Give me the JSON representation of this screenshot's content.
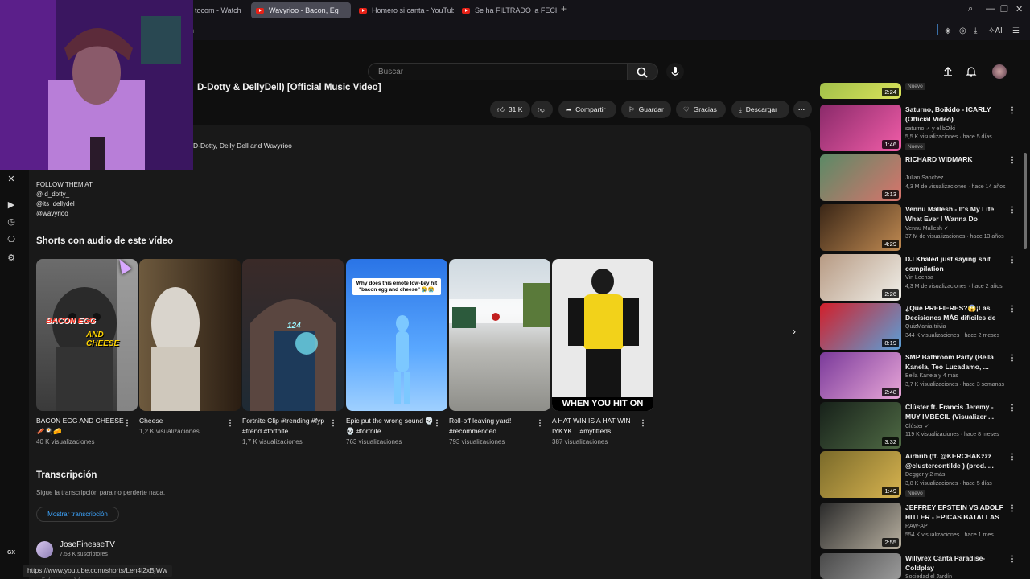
{
  "browser": {
    "tabs": [
      {
        "label": "tocom - Watch",
        "active": false
      },
      {
        "label": "Wavyrioo - Bacon, Eg",
        "active": true
      },
      {
        "label": "Homero si canta - YouTub",
        "active": false
      },
      {
        "label": "Se ha FILTRADO la FECHA",
        "active": false
      }
    ],
    "new_tab": "+",
    "address_fragment": "h",
    "ai_label": "AI"
  },
  "sidebar_gx": {
    "label": "GX"
  },
  "header": {
    "search_placeholder": "Buscar"
  },
  "video": {
    "title": "D-Dotty & DellyDell) [Official Music Video]",
    "actions": {
      "likes": "31 K",
      "share": "Compartir",
      "save": "Guardar",
      "thanks": "Gracias",
      "download": "Descargar"
    }
  },
  "description": {
    "artists": "D-Dotty, Delly Dell and Wavyrioo",
    "follow_lines": [
      "FOLLOW THEM AT",
      "@ d_dotty_",
      "@its_dellydel",
      "@wavyrioo"
    ]
  },
  "shorts": {
    "heading": "Shorts con audio de este vídeo",
    "items": [
      {
        "title": "BACON EGG AND CHEESE 🥓🍳🧀 ...",
        "views": "40 K visualizaciones",
        "caption1": "BACON EGG",
        "caption2": "AND CHEESE"
      },
      {
        "title": "Cheese",
        "views": "1,2 K visualizaciones"
      },
      {
        "title": "Fortnite Clip #trending #fyp #trend #fortnite",
        "views": "1,7 K visualizaciones",
        "caption1": "124"
      },
      {
        "title": "Epic put the wrong sound 💀💀 #fortnite ...",
        "views": "763 visualizaciones",
        "caption1": "Why does this emote low-key hit \"bacon egg and cheese\" 😭😭"
      },
      {
        "title": "Roll-off leaving yard! #recommended ...",
        "views": "793 visualizaciones"
      },
      {
        "title": "A HAT WIN IS A HAT WIN IYKYK ...#myfitteds ...",
        "views": "387 visualizaciones",
        "caption1": "WHEN YOU HIT ON"
      }
    ]
  },
  "transcript": {
    "heading": "Transcripción",
    "subtitle": "Sigue la transcripción para no perderte nada.",
    "button": "Mostrar transcripción"
  },
  "channel": {
    "name": "JoseFinesseTV",
    "subs": "7,53 K suscriptores"
  },
  "status_url": "https://www.youtube.com/shorts/Len4l2xBjWw",
  "under_tabs": "[▶] Vídeos    [ℹ] Información",
  "related": [
    {
      "title": "",
      "channel": "",
      "meta": "",
      "badge": "Nuevo",
      "duration": "2:24",
      "colors": [
        "#a2c04a",
        "#d9e25a"
      ]
    },
    {
      "title": "Saturno, Boikido - ICARLY (Official Video)",
      "channel": "saturno ✓ y el bOiki",
      "meta": "5,5 K visualizaciones · hace 5 días",
      "badge": "Nuevo",
      "duration": "1:46",
      "colors": [
        "#8a2a6a",
        "#f15da8"
      ]
    },
    {
      "title": "RICHARD WIDMARK",
      "channel": "Julian Sanchez",
      "meta": "4,3 M de visualizaciones · hace 14 años",
      "badge": "",
      "duration": "2:13",
      "colors": [
        "#5a8a66",
        "#d8746c"
      ]
    },
    {
      "title": "Vennu Mallesh - It's My Life What Ever I Wanna Do",
      "channel": "Vennu Mallesh ✓",
      "meta": "37 M de visualizaciones · hace 13 años",
      "badge": "",
      "duration": "4:29",
      "colors": [
        "#3a2616",
        "#c08a52"
      ]
    },
    {
      "title": "DJ Khaled just saying shit compilation",
      "channel": "Vin Leensa",
      "meta": "4,3 M de visualizaciones · hace 2 años",
      "badge": "",
      "duration": "2:26",
      "colors": [
        "#b79a83",
        "#f0efe9"
      ]
    },
    {
      "title": "¿Qué PREFIERES?😱¡Las Decisiones MÁS difíciles de T...",
      "channel": "QuizMania-trivia",
      "meta": "344 K visualizaciones · hace 2 meses",
      "badge": "",
      "duration": "8:19",
      "colors": [
        "#d21f2a",
        "#5aa0d8"
      ]
    },
    {
      "title": "SMP Bathroom Party (Bella Kanela, Teo Lucadamo, ...",
      "channel": "Bella Kanela y 4 más",
      "meta": "3,7 K visualizaciones · hace 3 semanas",
      "badge": "",
      "duration": "2:48",
      "colors": [
        "#7a3a9a",
        "#e8a6d8"
      ]
    },
    {
      "title": "Clúster ft. Francis Jeremy - MUY IMBÉCIL (Visualizer ...",
      "channel": "Clúster ✓",
      "meta": "119 K visualizaciones · hace 8 meses",
      "badge": "",
      "duration": "3:32",
      "colors": [
        "#17211a",
        "#4f6a44"
      ]
    },
    {
      "title": "Airbrib (ft. @KERCHAKzzz @clustercontilde ) (prod. ...",
      "channel": "Degger y 2 más",
      "meta": "3,8 K visualizaciones · hace 5 días",
      "badge": "Nuevo",
      "duration": "1:49",
      "colors": [
        "#7a6a2a",
        "#d8b450"
      ]
    },
    {
      "title": "JEFFREY EPSTEIN VS ADOLF HITLER - EPICAS BATALLAS ...",
      "channel": "RAW-AP",
      "meta": "554 K visualizaciones · hace 1 mes",
      "badge": "",
      "duration": "2:55",
      "colors": [
        "#2a2a2a",
        "#b8b0a0"
      ]
    },
    {
      "title": "Willyrex Canta Paradise- Coldplay",
      "channel": "Sociedad el Jardín",
      "meta": "",
      "badge": "",
      "duration": "",
      "colors": [
        "#4a4a4a",
        "#9a9a9a"
      ]
    }
  ],
  "icons": {
    "close": "close-icon",
    "play": "play-circle-icon",
    "history": "clock-icon",
    "library": "library-icon",
    "settings": "gear-icon",
    "search": "search-icon",
    "mic": "mic-icon",
    "upload": "upload-icon",
    "bell": "bell-icon"
  }
}
